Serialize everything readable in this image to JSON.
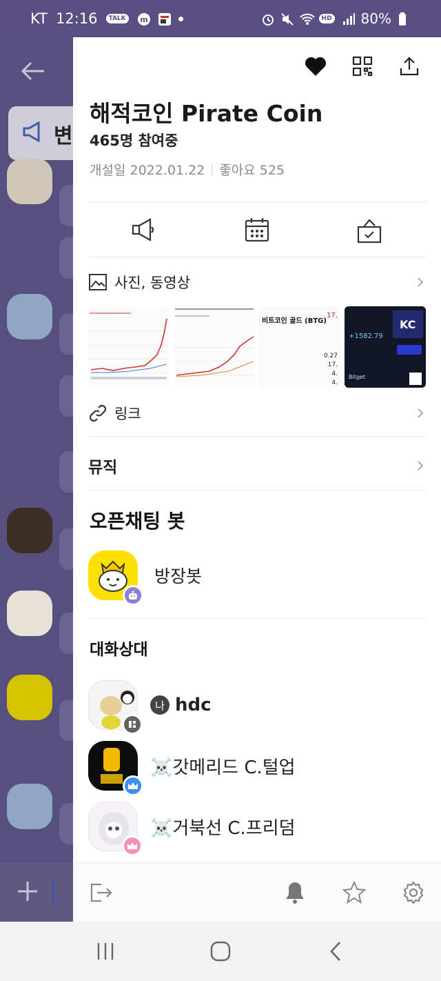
{
  "status_bar": {
    "carrier": "KT",
    "time": "12:16",
    "battery": "80%",
    "talk_label": "TALK",
    "hd_label": "HD"
  },
  "background_chat": {
    "notice_label": "변"
  },
  "room": {
    "title": "해적코인 Pirate Coin",
    "members": "465명 참여중",
    "created": "개설일 2022.01.22",
    "likes": "좋아요 525"
  },
  "sections": {
    "media": "사진, 동영상",
    "links": "링크",
    "music": "뮤직",
    "bots": "오픈채팅 봇",
    "participants": "대화상대"
  },
  "thumbnails": [
    {
      "kind": "chart"
    },
    {
      "kind": "chart"
    },
    {
      "kind": "table",
      "title": "비트코인 골드 (BTG)",
      "value": "17,",
      "rows": [
        "0.27",
        "17.",
        "4.",
        "4."
      ]
    },
    {
      "kind": "promo",
      "value": "+1582.79",
      "brand": "Bitget"
    }
  ],
  "bot": {
    "name": "방장봇"
  },
  "participants": [
    {
      "name": "hdc",
      "me_badge": "나",
      "badge_color": "#5f6366"
    },
    {
      "name": "☠️갓메리드 C.털업",
      "badge_color": "#3a8ff0"
    },
    {
      "name": "☠️거북선 C.프리덤",
      "badge_color": "#f58fb8"
    }
  ],
  "icons": {
    "top": [
      "heart-icon",
      "qr-code-icon",
      "share-icon"
    ],
    "actions": [
      "notice-megaphone-icon",
      "calendar-icon",
      "vote-icon"
    ],
    "footer": [
      "exit-icon",
      "bell-icon",
      "star-icon",
      "settings-gear-icon"
    ]
  },
  "colors": {
    "accent_purple": "#5a4f82",
    "bot_yellow": "#fce100",
    "robot_badge": "#8b7fd6"
  }
}
